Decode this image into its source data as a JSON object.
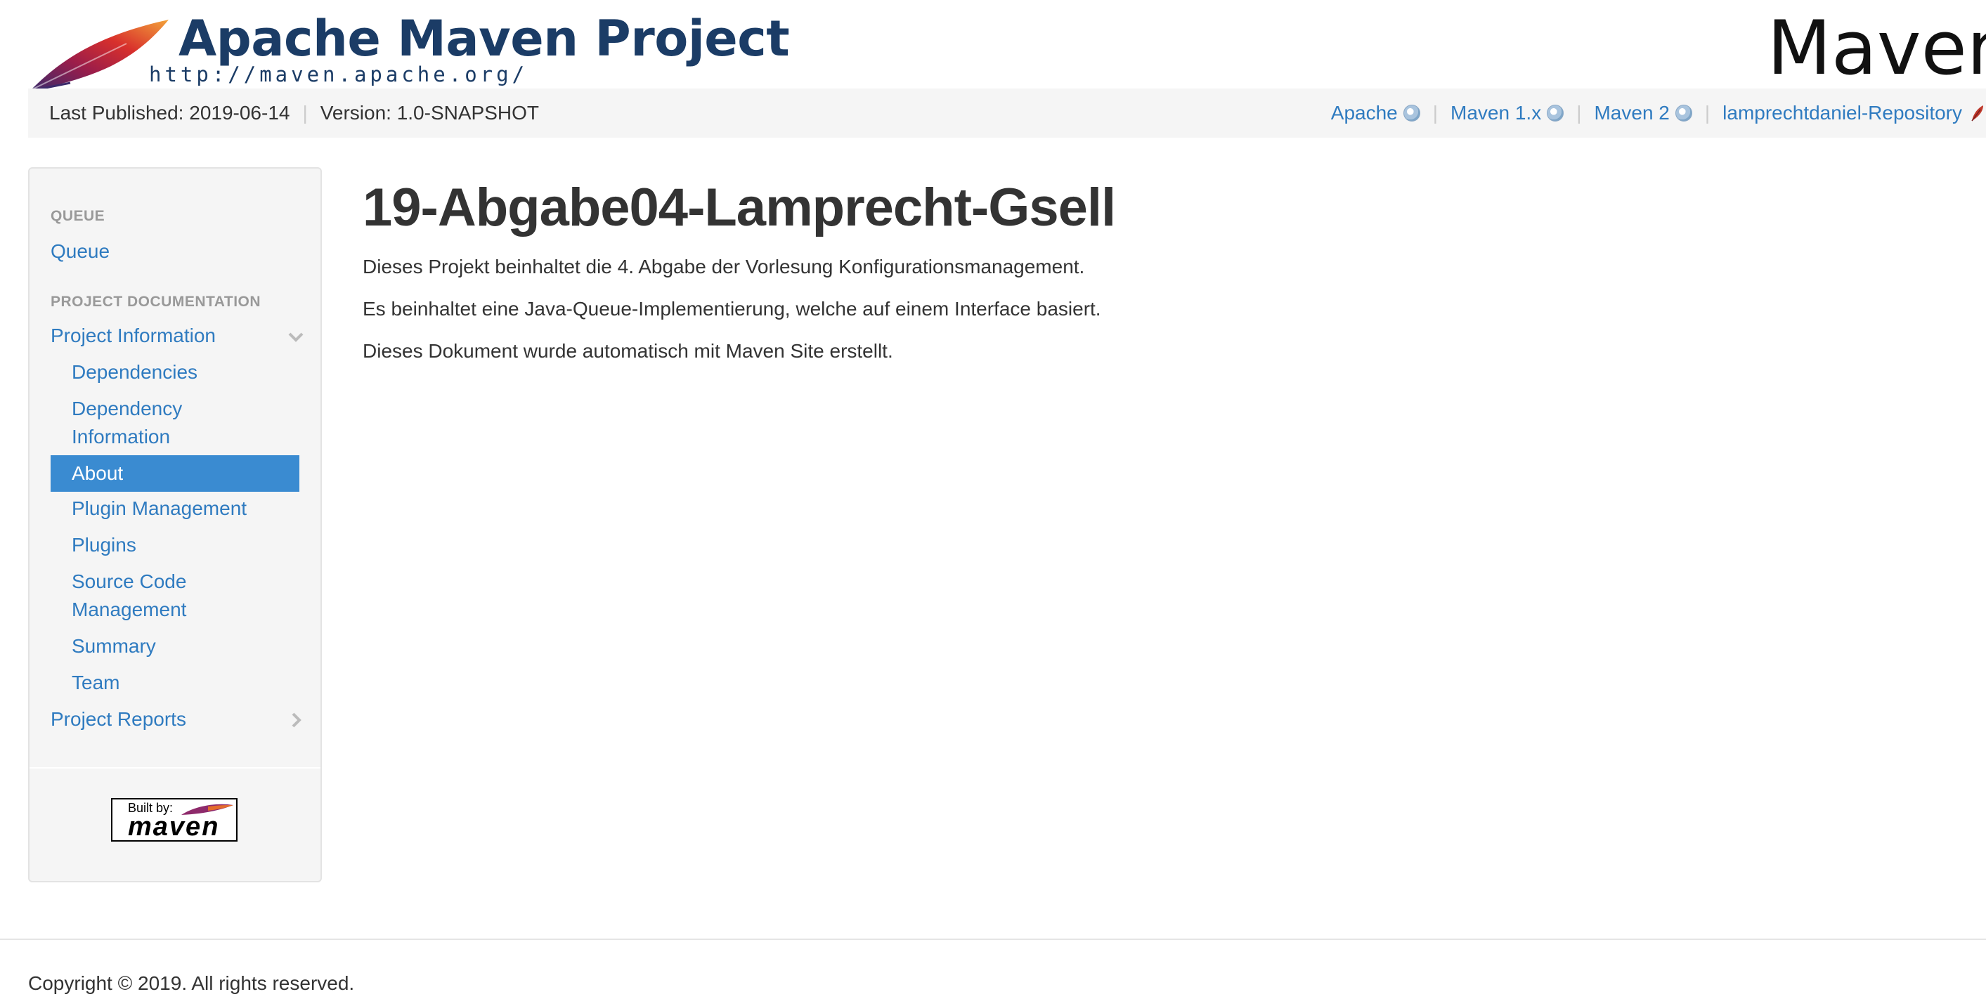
{
  "banner": {
    "title": "Apache Maven Project",
    "url": "http://maven.apache.org/",
    "right_text": "Maven"
  },
  "breadcrumbs": {
    "last_published": "Last Published: 2019-06-14",
    "version": "Version: 1.0-SNAPSHOT",
    "links": [
      {
        "label": "Apache",
        "icon": "external-link-icon"
      },
      {
        "label": "Maven 1.x",
        "icon": "external-link-icon"
      },
      {
        "label": "Maven 2",
        "icon": "external-link-icon"
      },
      {
        "label": "lamprechtdaniel-Repository",
        "icon": "feather-icon"
      }
    ]
  },
  "sidebar": {
    "sections": [
      {
        "header": "QUEUE"
      },
      {
        "header": "PROJECT DOCUMENTATION"
      }
    ],
    "items": [
      {
        "label": "Queue"
      },
      {
        "label": "Project Information",
        "expanded": true
      },
      {
        "label": "Dependencies"
      },
      {
        "label": "Dependency",
        "label2": "Information"
      },
      {
        "label": "About",
        "active": true
      },
      {
        "label": "Plugin Management"
      },
      {
        "label": "Plugins"
      },
      {
        "label": "Source Code",
        "label2": "Management"
      },
      {
        "label": "Summary"
      },
      {
        "label": "Team"
      },
      {
        "label": "Project Reports",
        "expanded": false
      }
    ],
    "built_by": {
      "label": "Built by:",
      "word": "maven"
    }
  },
  "main": {
    "title": "19-Abgabe04-Lamprecht-Gsell",
    "paragraphs": [
      "Dieses Projekt beinhaltet die 4. Abgabe der Vorlesung Konfigurationsmanagement.",
      "Es beinhaltet eine Java-Queue-Implementierung, welche auf einem Interface basiert.",
      "Dieses Dokument wurde automatisch mit Maven Site erstellt."
    ]
  },
  "footer": {
    "copyright": "Copyright © 2019. All rights reserved."
  },
  "colors": {
    "link": "#2f7bc0",
    "active_bg": "#3a8bd1",
    "banner_title": "#1b3c66",
    "bar_bg": "#f5f5f5"
  }
}
